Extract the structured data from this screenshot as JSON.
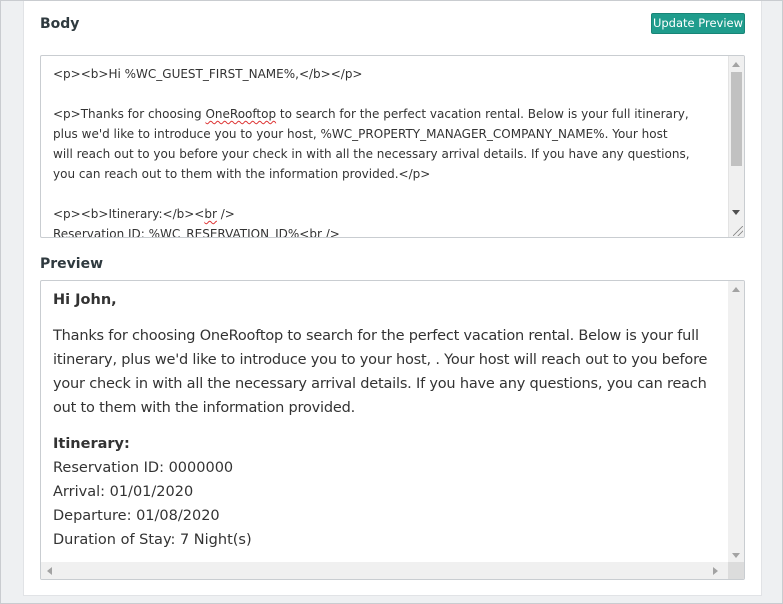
{
  "body_section": {
    "title": "Body",
    "update_button": "Update Preview",
    "editor_lines": [
      {
        "pre": "<p><b>Hi %WC_GUEST_FIRST_NAME%,</b></p>",
        "wavy": "",
        "post": ""
      },
      {
        "pre": "",
        "wavy": "",
        "post": ""
      },
      {
        "pre": "<p>Thanks for choosing ",
        "wavy": "OneRooftop",
        "post": " to search for the perfect vacation rental. Below is your full itinerary,"
      },
      {
        "pre": "plus we'd like to introduce you to your host, %WC_PROPERTY_MANAGER_COMPANY_NAME%. Your host",
        "wavy": "",
        "post": ""
      },
      {
        "pre": "will reach out to you before your check in with all the necessary arrival details. If you have any questions,",
        "wavy": "",
        "post": ""
      },
      {
        "pre": "you can reach out to them with the information provided.</p>",
        "wavy": "",
        "post": ""
      },
      {
        "pre": "",
        "wavy": "",
        "post": ""
      },
      {
        "pre": "<p><b>Itinerary:</b><",
        "wavy": "br",
        "post": " />"
      },
      {
        "pre": "Reservation ID: %WC_RESERVATION_ID%<br />",
        "wavy": "",
        "post": ""
      }
    ]
  },
  "preview_section": {
    "title": "Preview",
    "greeting": "Hi John,",
    "paragraph": "Thanks for choosing OneRooftop to search for the perfect vacation rental. Below is your full itinerary, plus we'd like to introduce you to your host, . Your host will reach out to you before your check in with all the necessary arrival details. If you have any questions, you can reach out to them with the information provided.",
    "itinerary_title": "Itinerary:",
    "reservation_id": "Reservation ID: 0000000",
    "arrival": "Arrival: 01/01/2020",
    "departure": "Departure: 01/08/2020",
    "duration": "Duration of Stay: 7 Night(s)"
  }
}
